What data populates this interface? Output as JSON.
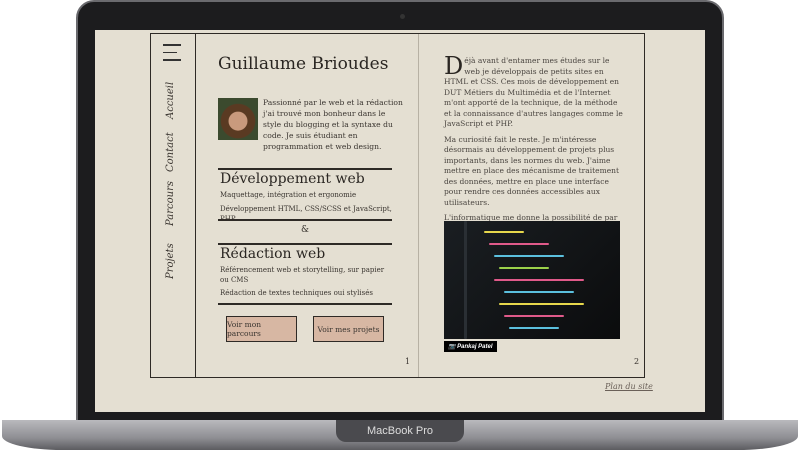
{
  "device": {
    "label": "MacBook Pro"
  },
  "sidebar": {
    "menu_icon": "hamburger-icon",
    "items": [
      {
        "label": "Accueil"
      },
      {
        "label": "Contact"
      },
      {
        "label": "Parcours"
      },
      {
        "label": "Projets"
      }
    ]
  },
  "page1": {
    "title": "Guillaume Brioudes",
    "intro": "Passionné par le web et la rédaction j'ai trouvé mon bonheur dans le style du blogging et la syntaxe du code. Je suis étudiant en programmation et web design.",
    "dev": {
      "heading": "Développement web",
      "line1": "Maquettage, intégration et ergonomie",
      "line2": "Développement HTML, CSS/SCSS et JavaScript, PHP"
    },
    "ampersand": "&",
    "redac": {
      "heading": "Rédaction web",
      "line1": "Référencement web et storytelling, sur papier ou CMS",
      "line2": "Rédaction de textes techniques oui stylisés"
    },
    "buttons": {
      "parcours": "Voir mon parcours",
      "projets": "Voir mes projets"
    },
    "page_number": "1"
  },
  "page2": {
    "dropcap": "D",
    "p1": "éjà avant d'entamer mes études sur le web je développais de petits sites en HTML et CSS. Ces mois de développement en DUT Métiers du Multimédia et de l'Internet m'ont apporté de la technique, de la méthode et la connaissance d'autres langages comme le JavaScript et PHP.",
    "p2": "Ma curiosité fait le reste. Je m'intéresse désormais au développement de projets plus importants, dans les normes du web. J'aime mettre en place des mécanisme de traitement des données, mettre en place une interface pour rendre ces données accessibles aux utilisateurs.",
    "p3": "L'informatique me donne la possibilité de par le texte de créer ce que je ne sais dessiner, d'afficher de l'information en bonne et due forme à l'internaute.",
    "photo_credit": "Pankaj Patel",
    "page_number": "2"
  },
  "footer": {
    "sitemap": "Plan du site"
  }
}
